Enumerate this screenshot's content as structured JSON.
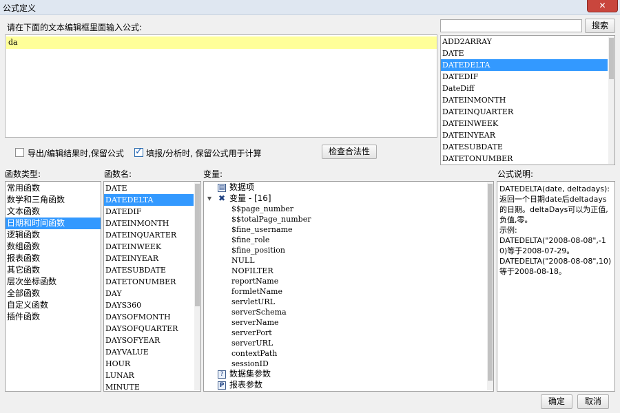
{
  "window": {
    "title": "公式定义",
    "close_glyph": "✕"
  },
  "editor": {
    "prompt_label": "请在下面的文本编辑框里面输入公式:",
    "value": "da"
  },
  "search": {
    "placeholder": "",
    "value": "",
    "button_label": "搜索"
  },
  "suggestions": {
    "items": [
      "ADD2ARRAY",
      "DATE",
      "DATEDELTA",
      "DATEDIF",
      "DateDiff",
      "DATEINMONTH",
      "DATEINQUARTER",
      "DATEINWEEK",
      "DATEINYEAR",
      "DATESUBDATE",
      "DATETONUMBER"
    ],
    "selected": "DATEDELTA"
  },
  "options": {
    "export_keep_formula": {
      "label": "导出/编辑结果时,保留公式",
      "checked": false
    },
    "fill_keep_formula": {
      "label": "填报/分析时, 保留公式用于计算",
      "checked": true
    },
    "check_button": "检查合法性"
  },
  "function_types": {
    "label": "函数类型:",
    "items": [
      "常用函数",
      "数学和三角函数",
      "文本函数",
      "日期和时间函数",
      "逻辑函数",
      "数组函数",
      "报表函数",
      "其它函数",
      "层次坐标函数",
      "全部函数",
      "自定义函数",
      "插件函数"
    ],
    "selected": "日期和时间函数"
  },
  "function_names": {
    "label": "函数名:",
    "items": [
      "DATE",
      "DATEDELTA",
      "DATEDIF",
      "DATEINMONTH",
      "DATEINQUARTER",
      "DATEINWEEK",
      "DATEINYEAR",
      "DATESUBDATE",
      "DATETONUMBER",
      "DAY",
      "DAYS360",
      "DAYSOFMONTH",
      "DAYSOFQUARTER",
      "DAYSOFYEAR",
      "DAYVALUE",
      "HOUR",
      "LUNAR",
      "MINUTE"
    ],
    "selected": "DATEDELTA"
  },
  "variables": {
    "label": "变量:",
    "data_items": "数据项",
    "variables_group": "变量 - [16]",
    "items": [
      "$$page_number",
      "$$totalPage_number",
      "$fine_username",
      "$fine_role",
      "$fine_position",
      "NULL",
      "NOFILTER",
      "reportName",
      "formletName",
      "servletURL",
      "serverSchema",
      "serverName",
      "serverPort",
      "serverURL",
      "contextPath",
      "sessionID"
    ],
    "dataset_params": "数据集参数",
    "report_params": "报表参数",
    "icons": {
      "data_items": "table-icon",
      "variables_group": "variable-icon",
      "dataset_params": "dataset-param-icon",
      "report_params": "report-param-icon"
    }
  },
  "description": {
    "label": "公式说明:",
    "lines": [
      "DATEDELTA(date, deltadays):",
      "返回一个日期date后deltadays的日期。deltaDays可以为正值,负值,零。",
      "示例:",
      "DATEDELTA(\"2008-08-08\",-10)等于2008-07-29。",
      "DATEDELTA(\"2008-08-08\",10)等于2008-08-18。"
    ]
  },
  "footer": {
    "ok": "确定",
    "cancel": "取消"
  },
  "colors": {
    "selection": "#3399ff",
    "editor_highlight": "#ffff99",
    "close": "#c9463d"
  }
}
